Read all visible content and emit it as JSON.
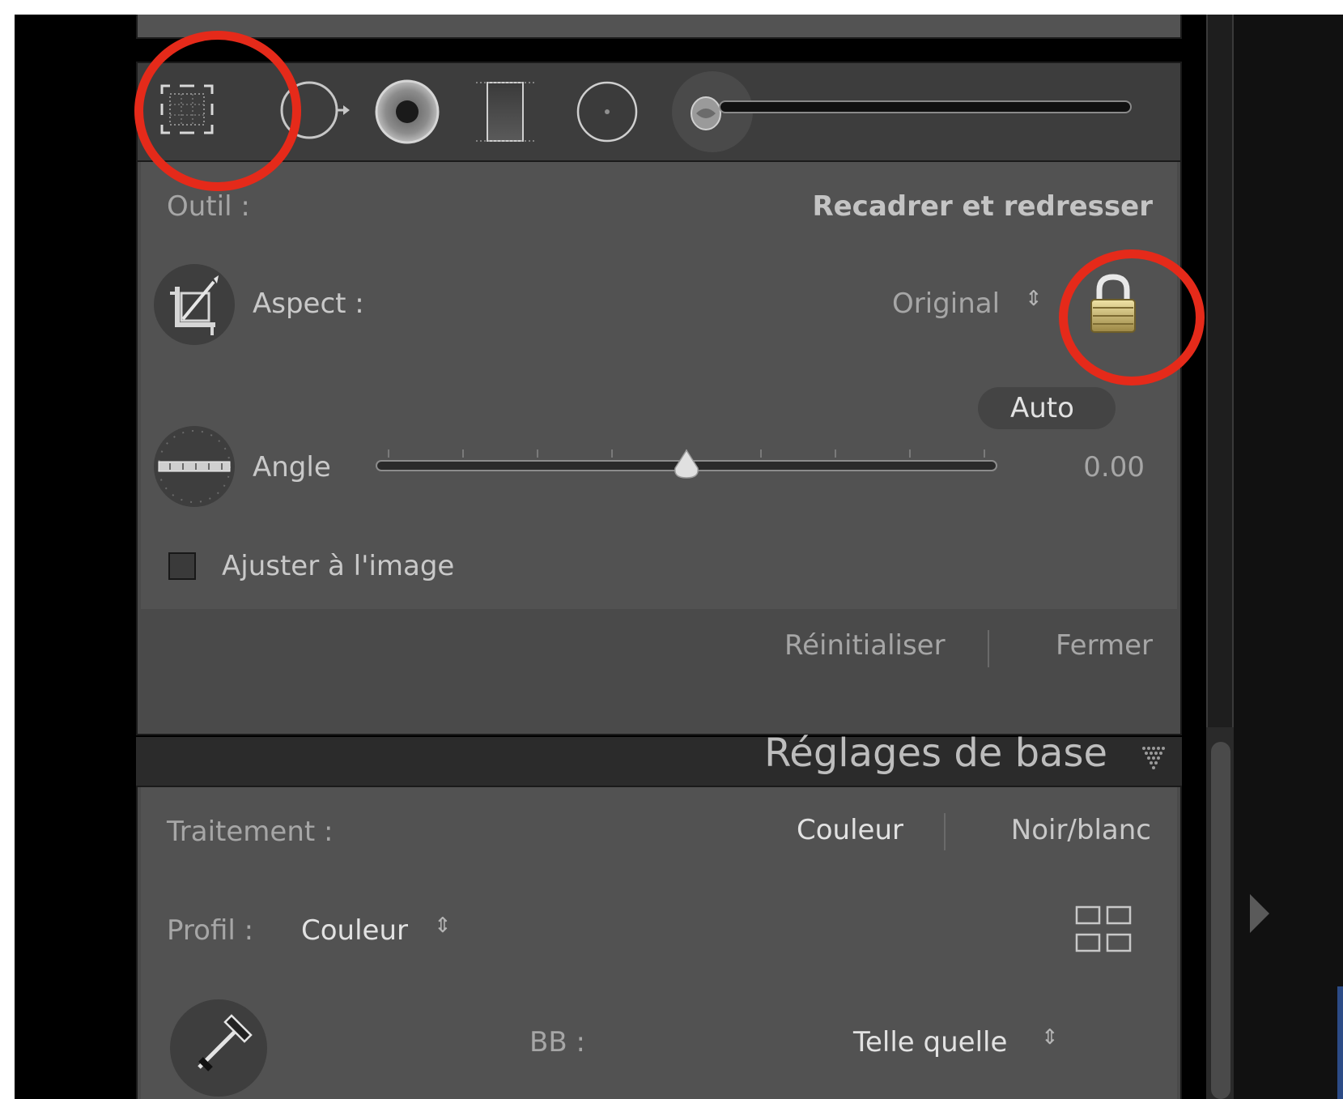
{
  "colors": {
    "annotation_ring": "#e52a1a",
    "panel_background": "#525252",
    "panel_text": "#c9c9c9",
    "lock_gold": "#c8b46a"
  },
  "tool_strip": {
    "tools": [
      {
        "name": "crop-overlay-tool",
        "icon": "crop-icon"
      },
      {
        "name": "spot-removal-tool",
        "icon": "spot-removal-icon"
      },
      {
        "name": "red-eye-tool",
        "icon": "red-eye-icon"
      },
      {
        "name": "graduated-filter-tool",
        "icon": "graduated-filter-icon"
      },
      {
        "name": "radial-filter-tool",
        "icon": "radial-filter-icon"
      },
      {
        "name": "adjustment-brush-tool",
        "icon": "brush-icon"
      }
    ]
  },
  "crop_panel": {
    "tool_label": "Outil :",
    "tool_name": "Recadrer et redresser",
    "aspect_label": "Aspect :",
    "aspect_value": "Original",
    "aspect_locked": true,
    "auto_button": "Auto",
    "angle_label": "Angle",
    "angle_value": "0.00",
    "angle_slider_fraction": 0.5,
    "constrain_label": "Ajuster à l'image",
    "constrain_checked": false,
    "reset_label": "Réinitialiser",
    "close_label": "Fermer"
  },
  "basic_panel": {
    "title": "Réglages de base",
    "treatment_label": "Traitement :",
    "treatment_color": "Couleur",
    "treatment_bw": "Noir/blanc",
    "profile_label": "Profil :",
    "profile_value": "Couleur",
    "wb_label": "BB :",
    "wb_value": "Telle quelle"
  }
}
